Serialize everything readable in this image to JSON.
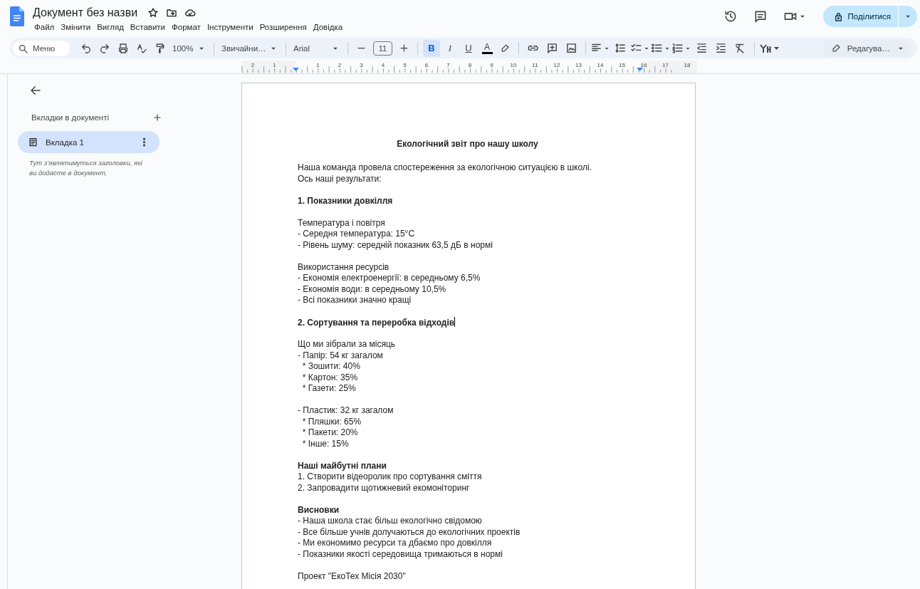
{
  "header": {
    "title": "Документ без назви",
    "menu": [
      "Файл",
      "Змінити",
      "Вигляд",
      "Вставити",
      "Формат",
      "Інструменти",
      "Розширення",
      "Довідка"
    ],
    "share": "Поділитися"
  },
  "toolbar": {
    "search_placeholder": "Меню",
    "zoom": "100%",
    "style": "Звичайни…",
    "font": "Arial",
    "font_size": "11",
    "format": [
      {
        "kind": "bold",
        "label": "B",
        "selected": true
      },
      {
        "kind": "italic",
        "label": "I",
        "selected": false
      },
      {
        "kind": "underline",
        "label": "U",
        "selected": false
      },
      {
        "kind": "color",
        "label": "A",
        "selected": false
      }
    ],
    "mode": "Редагува…"
  },
  "ruler": {
    "left_labels": [
      "2",
      "1"
    ],
    "right_labels": [
      "1",
      "2",
      "3",
      "4",
      "5",
      "6",
      "7",
      "8",
      "9",
      "10",
      "11",
      "12",
      "13",
      "14",
      "15",
      "16",
      "17",
      "18"
    ]
  },
  "sidebar": {
    "heading": "Вкладки в документі",
    "tabs": [
      {
        "label": "Вкладка 1",
        "selected": true
      }
    ],
    "hint": "Тут з’являтимуться заголовки, які ви додасте в документ."
  },
  "document": {
    "lines": [
      {
        "kind": "title",
        "text": "Екологічний звіт про нашу школу"
      },
      {
        "kind": "gap"
      },
      {
        "kind": "text",
        "text": "Наша команда провела спостереження за екологічною ситуацією в школі."
      },
      {
        "kind": "text",
        "text": "Ось наші результати:"
      },
      {
        "kind": "gap"
      },
      {
        "kind": "bold",
        "text": "1. Показники довкілля"
      },
      {
        "kind": "gap"
      },
      {
        "kind": "text",
        "text": "Температура і повітря"
      },
      {
        "kind": "text",
        "text": "- Середня температура: 15°C"
      },
      {
        "kind": "text",
        "text": "- Рівень шуму: середній показник 63,5 дБ в нормі"
      },
      {
        "kind": "gap"
      },
      {
        "kind": "text",
        "text": "Використання ресурсів"
      },
      {
        "kind": "text",
        "text": "- Економія електроенергії: в середньому 6,5%"
      },
      {
        "kind": "text",
        "text": "- Економія води: в середньому 10,5%"
      },
      {
        "kind": "text",
        "text": "- Всі показники значно кращі"
      },
      {
        "kind": "gap"
      },
      {
        "kind": "bold",
        "text": "2. Сортування та переробка відходів",
        "cursor": true
      },
      {
        "kind": "gap"
      },
      {
        "kind": "text",
        "text": "Що ми зібрали за місяць"
      },
      {
        "kind": "text",
        "text": "- Папір: 54 кг загалом"
      },
      {
        "kind": "text",
        "text": "  * Зошити: 40%"
      },
      {
        "kind": "text",
        "text": "  * Картон: 35%"
      },
      {
        "kind": "text",
        "text": "  * Газети: 25%"
      },
      {
        "kind": "gap"
      },
      {
        "kind": "text",
        "text": "- Пластик: 32 кг загалом"
      },
      {
        "kind": "text",
        "text": "  * Пляшки: 65%"
      },
      {
        "kind": "text",
        "text": "  * Пакети: 20%"
      },
      {
        "kind": "text",
        "text": "  * Інше: 15%"
      },
      {
        "kind": "gap"
      },
      {
        "kind": "bold",
        "text": "Наші майбутні плани"
      },
      {
        "kind": "text",
        "text": "1. Створити відеоролик про сортування сміття"
      },
      {
        "kind": "text",
        "text": "2. Запровадити щотижневий екомоніторинг"
      },
      {
        "kind": "gap"
      },
      {
        "kind": "bold",
        "text": "Висновки"
      },
      {
        "kind": "text",
        "text": "- Наша школа стає більш екологічно свідомою"
      },
      {
        "kind": "text",
        "text": "- Все більше учнів долучаються до екологічних проектів"
      },
      {
        "kind": "text",
        "text": "- Ми економимо ресурси та дбаємо про довкілля"
      },
      {
        "kind": "text",
        "text": "- Показники якості середовища тримаються в нормі"
      },
      {
        "kind": "gap"
      },
      {
        "kind": "text",
        "text": "Проект \"ЕкоТех Місія 2030\""
      }
    ]
  }
}
